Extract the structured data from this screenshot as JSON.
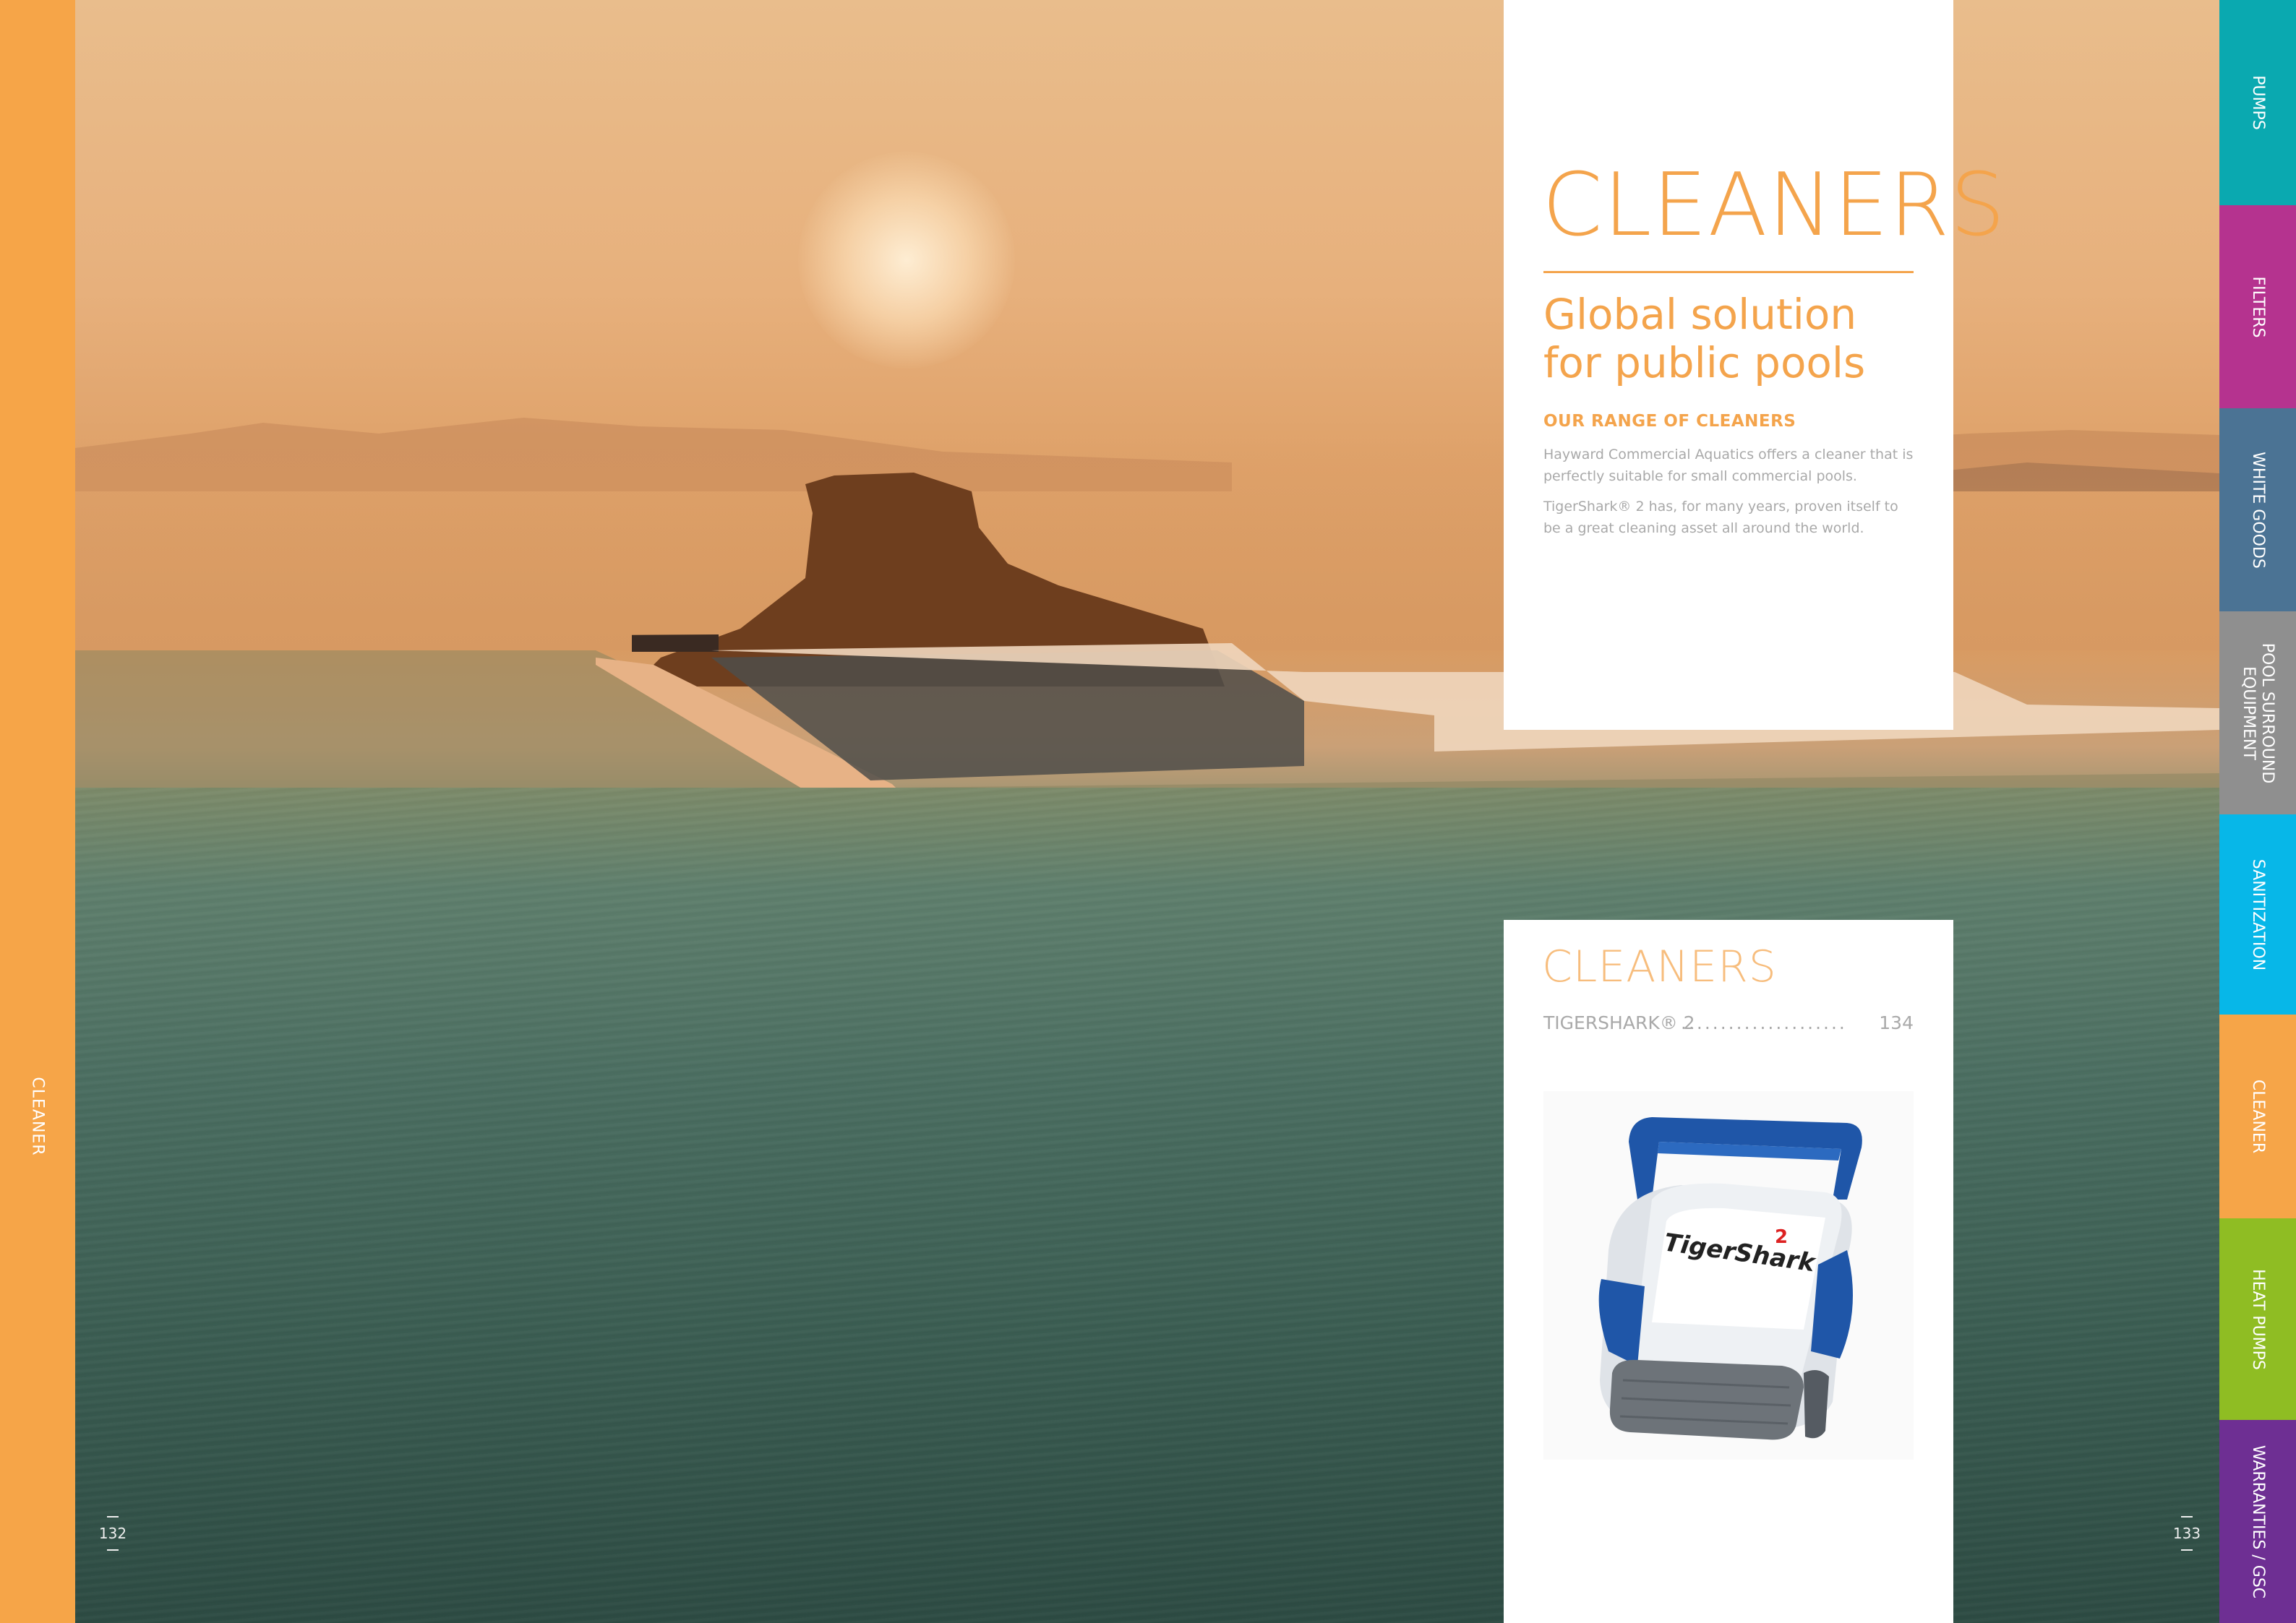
{
  "left_tab": {
    "label": "CLEANER",
    "color": "#f6a548"
  },
  "page_numbers": {
    "left": "132",
    "right": "133"
  },
  "hero": {
    "title": "CLEANERS",
    "subtitle_line1": "Global solution",
    "subtitle_line2": "for public pools",
    "section_label": "OUR RANGE OF CLEANERS",
    "paragraph1": "Hayward Commercial Aquatics offers a cleaner that is perfectly suitable for small commercial pools.",
    "paragraph2": "TigerShark® 2 has, for many years, proven itself to be a great cleaning asset all around the world."
  },
  "index": {
    "title": "CLEANERS",
    "items": [
      {
        "name": "TIGERSHARK® 2",
        "dots": ".....................",
        "page": "134"
      }
    ]
  },
  "product_image": {
    "brand_text": "TigerShark",
    "superscript": "2"
  },
  "tabs": [
    {
      "label": "PUMPS",
      "color": "#0aa9b0"
    },
    {
      "label": "FILTERS",
      "color": "#b5338f"
    },
    {
      "label": "WHITE GOODS",
      "color": "#4b7394"
    },
    {
      "label_line1": "POOL SURROUND",
      "label_line2": "EQUIPMENT",
      "color": "#8f8f8f"
    },
    {
      "label": "SANITIZATION",
      "color": "#07b7e8"
    },
    {
      "label": "CLEANER",
      "color": "#f6a548"
    },
    {
      "label": "HEAT PUMPS",
      "color": "#8fbd23"
    },
    {
      "label": "WARRANTIES / GSC",
      "color": "#6e2f93"
    }
  ],
  "accent_color": "#f4a44c"
}
